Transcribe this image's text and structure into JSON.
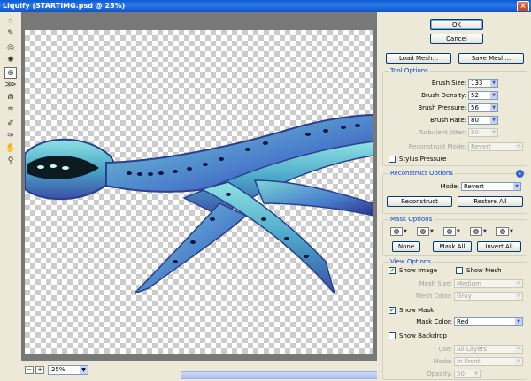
{
  "window": {
    "title": "Liquify (STARTIMG.psd @ 25%)",
    "close": "×"
  },
  "tools": [
    {
      "icon": "forward-warp-icon",
      "glyph": "☝"
    },
    {
      "icon": "reconstruct-icon",
      "glyph": "✎"
    },
    {
      "icon": "twirl-clockwise-icon",
      "glyph": "◎"
    },
    {
      "icon": "pucker-icon",
      "glyph": "✺"
    },
    {
      "icon": "bloat-icon",
      "glyph": "⊕"
    },
    {
      "icon": "push-left-icon",
      "glyph": "⋙"
    },
    {
      "icon": "mirror-icon",
      "glyph": "⋒"
    },
    {
      "icon": "turbulence-icon",
      "glyph": "≋"
    },
    {
      "icon": "freeze-mask-icon",
      "glyph": "✐"
    },
    {
      "icon": "thaw-mask-icon",
      "glyph": "✑"
    },
    {
      "icon": "hand-icon",
      "glyph": "✋"
    },
    {
      "icon": "zoom-icon",
      "glyph": "⚲"
    }
  ],
  "status": {
    "zoom_out": "−",
    "zoom_in": "+",
    "zoom_value": "25%"
  },
  "buttons": {
    "ok": "OK",
    "cancel": "Cancel",
    "load_mesh": "Load Mesh...",
    "save_mesh": "Save Mesh..."
  },
  "tool_options": {
    "title": "Tool Options",
    "brush_size_label": "Brush Size:",
    "brush_size": "133",
    "brush_density_label": "Brush Density:",
    "brush_density": "52",
    "brush_pressure_label": "Brush Pressure:",
    "brush_pressure": "56",
    "brush_rate_label": "Brush Rate:",
    "brush_rate": "80",
    "turbulent_jitter_label": "Turbulent Jitter:",
    "turbulent_jitter": "50",
    "reconstruct_mode_label": "Reconstruct Mode:",
    "reconstruct_mode": "Revert",
    "stylus_pressure": "Stylus Pressure"
  },
  "reconstruct_options": {
    "title": "Reconstruct Options",
    "mode_label": "Mode:",
    "mode": "Revert",
    "reconstruct": "Reconstruct",
    "restore_all": "Restore All"
  },
  "mask_options": {
    "title": "Mask Options",
    "none": "None",
    "mask_all": "Mask All",
    "invert_all": "Invert All"
  },
  "view_options": {
    "title": "View Options",
    "show_image": "Show Image",
    "show_mesh": "Show Mesh",
    "mesh_size_label": "Mesh Size:",
    "mesh_size": "Medium",
    "mesh_color_label": "Mesh Color:",
    "mesh_color": "Gray",
    "show_mask": "Show Mask",
    "mask_color_label": "Mask Color:",
    "mask_color": "Red",
    "show_backdrop": "Show Backdrop",
    "use_label": "Use:",
    "use": "All Layers",
    "mode_label": "Mode:",
    "mode": "In Front",
    "opacity_label": "Opacity:",
    "opacity": "50"
  }
}
